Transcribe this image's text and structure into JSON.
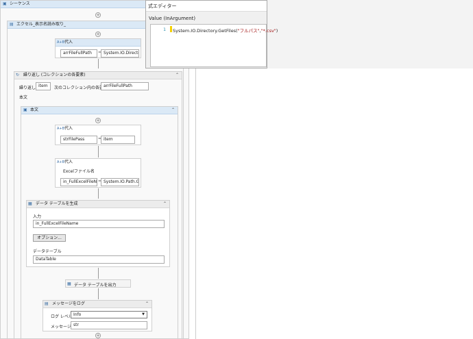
{
  "sequence": {
    "title": "シーケンス"
  },
  "excel_scope": {
    "title": "エクセル_表示名読み取り_"
  },
  "assign1": {
    "title": "代入",
    "left": "arrFileFullPath",
    "right": "System.IO.Director"
  },
  "foreach": {
    "title": "繰り返し (コレクションの各要素)",
    "label_repeat": "繰り返し",
    "item": "item",
    "label_in": "次のコレクション内の各要素:",
    "collection": "arrFileFullPath",
    "body_label": "本文"
  },
  "body": {
    "title": "本文",
    "assign2": {
      "title": "代入",
      "left": "strFilePass",
      "right": "item"
    },
    "assign3": {
      "title": "代入",
      "annotation": "Excelファイル名",
      "left": "in_FullExcelFileNan",
      "right": "System.IO.Path.Ge"
    },
    "build_table": {
      "title": "データ テーブルを生成",
      "input_label": "入力",
      "input_value": "in_FullExcelFileName",
      "options_label": "オプション...",
      "table_label": "データテーブル",
      "table_value": "DataTable"
    },
    "output_table": {
      "title": "データ テーブルを出力"
    },
    "log_message": {
      "title": "メッセージをログ",
      "level_label": "ログ レベル",
      "level_value": "Info",
      "message_label": "メッセージ",
      "message_value": "str"
    }
  },
  "editor": {
    "title": "式エディター",
    "value_label": "Value (InArgument)",
    "line_number": "1",
    "code_prefix": "System.IO.Directory.GetFiles(",
    "code_arg1": "\"フルパス\"",
    "code_sep": ",",
    "code_arg2": "\"*.csv\"",
    "code_suffix": ")"
  },
  "colors": {
    "header_blue": "#dbe9f6",
    "string_red": "#a31515",
    "line_marker": "#f5d100"
  }
}
